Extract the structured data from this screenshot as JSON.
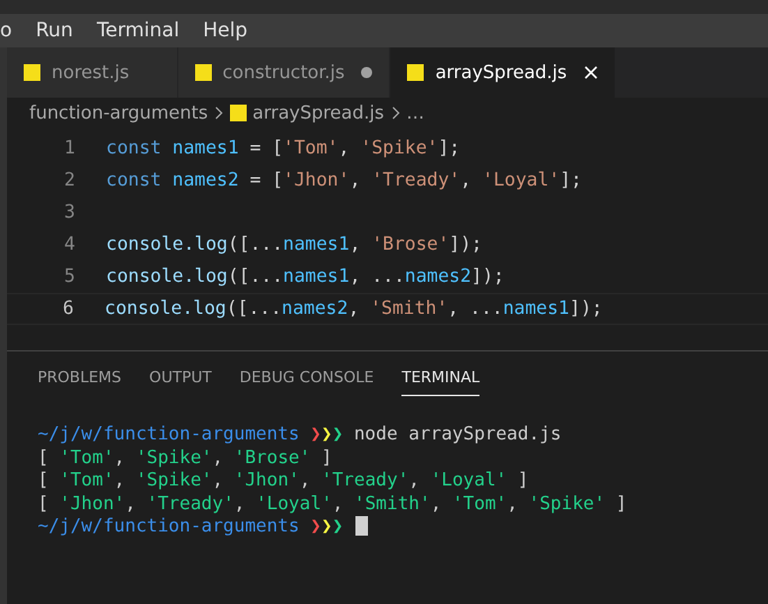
{
  "menu": [
    "o",
    "Run",
    "Terminal",
    "Help"
  ],
  "tabs": [
    {
      "label": "norest.js",
      "selected": false,
      "modified": false
    },
    {
      "label": "constructor.js",
      "selected": false,
      "modified": true
    },
    {
      "label": "arraySpread.js",
      "selected": true,
      "modified": false
    }
  ],
  "breadcrumb": {
    "folder": "function-arguments",
    "file": "arraySpread.js",
    "more": "…"
  },
  "editor": {
    "lines": [
      {
        "number": "1",
        "current": false,
        "tokens": [
          {
            "kind": "keyword",
            "text": "const "
          },
          {
            "kind": "variable",
            "text": "names1"
          },
          {
            "kind": "plain",
            "text": " = ["
          },
          {
            "kind": "string",
            "text": "'Tom'"
          },
          {
            "kind": "plain",
            "text": ", "
          },
          {
            "kind": "string",
            "text": "'Spike'"
          },
          {
            "kind": "plain",
            "text": "];"
          }
        ]
      },
      {
        "number": "2",
        "current": false,
        "tokens": [
          {
            "kind": "keyword",
            "text": "const "
          },
          {
            "kind": "variable",
            "text": "names2"
          },
          {
            "kind": "plain",
            "text": " = ["
          },
          {
            "kind": "string",
            "text": "'Jhon'"
          },
          {
            "kind": "plain",
            "text": ", "
          },
          {
            "kind": "string",
            "text": "'Tready'"
          },
          {
            "kind": "plain",
            "text": ", "
          },
          {
            "kind": "string",
            "text": "'Loyal'"
          },
          {
            "kind": "plain",
            "text": "];"
          }
        ]
      },
      {
        "number": "3",
        "current": false
      },
      {
        "number": "4",
        "current": false,
        "tokens": [
          {
            "kind": "member",
            "text": "console.log"
          },
          {
            "kind": "plain",
            "text": "([..."
          },
          {
            "kind": "variable",
            "text": "names1"
          },
          {
            "kind": "plain",
            "text": ", "
          },
          {
            "kind": "string",
            "text": "'Brose'"
          },
          {
            "kind": "plain",
            "text": "]);"
          }
        ]
      },
      {
        "number": "5",
        "current": false,
        "tokens": [
          {
            "kind": "member",
            "text": "console.log"
          },
          {
            "kind": "plain",
            "text": "([..."
          },
          {
            "kind": "variable",
            "text": "names1"
          },
          {
            "kind": "plain",
            "text": ", ..."
          },
          {
            "kind": "variable",
            "text": "names2"
          },
          {
            "kind": "plain",
            "text": "]);"
          }
        ]
      },
      {
        "number": "6",
        "current": true,
        "tokens": [
          {
            "kind": "member",
            "text": "console.log"
          },
          {
            "kind": "plain",
            "text": "([..."
          },
          {
            "kind": "variable",
            "text": "names2"
          },
          {
            "kind": "plain",
            "text": ", "
          },
          {
            "kind": "string",
            "text": "'Smith'"
          },
          {
            "kind": "plain",
            "text": ", ..."
          },
          {
            "kind": "variable",
            "text": "names1"
          },
          {
            "kind": "plain",
            "text": "]);"
          }
        ]
      }
    ]
  },
  "panel": {
    "tabs": [
      {
        "label": "PROBLEMS",
        "selected": false
      },
      {
        "label": "OUTPUT",
        "selected": false
      },
      {
        "label": "DEBUG CONSOLE",
        "selected": false
      },
      {
        "label": "TERMINAL",
        "selected": true
      }
    ],
    "terminal": [
      {
        "cursor": false,
        "segments": [
          {
            "kind": "path",
            "text": "~/j/w/function-arguments "
          },
          {
            "kind": "chevron",
            "text": "❯",
            "color": "#f14c4c"
          },
          {
            "kind": "chevron",
            "text": "❯",
            "color": "#f5f543"
          },
          {
            "kind": "chevron",
            "text": "❯",
            "color": "#23d18b"
          },
          {
            "kind": "plain",
            "text": " node arraySpread.js"
          }
        ]
      },
      {
        "cursor": false,
        "segments": [
          {
            "kind": "plain",
            "text": "[ "
          },
          {
            "kind": "string",
            "text": "'Tom'"
          },
          {
            "kind": "plain",
            "text": ", "
          },
          {
            "kind": "string",
            "text": "'Spike'"
          },
          {
            "kind": "plain",
            "text": ", "
          },
          {
            "kind": "string",
            "text": "'Brose'"
          },
          {
            "kind": "plain",
            "text": " ]"
          }
        ]
      },
      {
        "cursor": false,
        "segments": [
          {
            "kind": "plain",
            "text": "[ "
          },
          {
            "kind": "string",
            "text": "'Tom'"
          },
          {
            "kind": "plain",
            "text": ", "
          },
          {
            "kind": "string",
            "text": "'Spike'"
          },
          {
            "kind": "plain",
            "text": ", "
          },
          {
            "kind": "string",
            "text": "'Jhon'"
          },
          {
            "kind": "plain",
            "text": ", "
          },
          {
            "kind": "string",
            "text": "'Tready'"
          },
          {
            "kind": "plain",
            "text": ", "
          },
          {
            "kind": "string",
            "text": "'Loyal'"
          },
          {
            "kind": "plain",
            "text": " ]"
          }
        ]
      },
      {
        "cursor": false,
        "segments": [
          {
            "kind": "plain",
            "text": "[ "
          },
          {
            "kind": "string",
            "text": "'Jhon'"
          },
          {
            "kind": "plain",
            "text": ", "
          },
          {
            "kind": "string",
            "text": "'Tready'"
          },
          {
            "kind": "plain",
            "text": ", "
          },
          {
            "kind": "string",
            "text": "'Loyal'"
          },
          {
            "kind": "plain",
            "text": ", "
          },
          {
            "kind": "string",
            "text": "'Smith'"
          },
          {
            "kind": "plain",
            "text": ", "
          },
          {
            "kind": "string",
            "text": "'Tom'"
          },
          {
            "kind": "plain",
            "text": ", "
          },
          {
            "kind": "string",
            "text": "'Spike'"
          },
          {
            "kind": "plain",
            "text": " ]"
          }
        ]
      },
      {
        "cursor": true,
        "segments": [
          {
            "kind": "path",
            "text": "~/j/w/function-arguments "
          },
          {
            "kind": "chevron",
            "text": "❯",
            "color": "#f14c4c"
          },
          {
            "kind": "chevron",
            "text": "❯",
            "color": "#f5f543"
          },
          {
            "kind": "chevron",
            "text": "❯",
            "color": "#23d18b"
          }
        ]
      }
    ]
  }
}
